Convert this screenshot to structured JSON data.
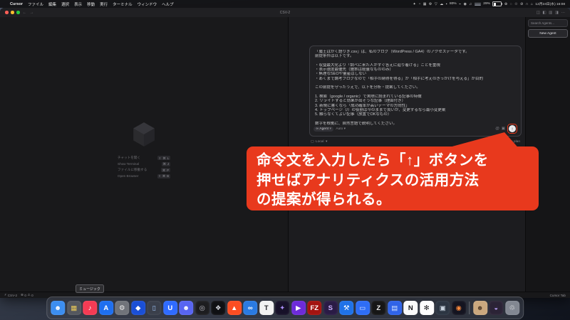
{
  "colors": {
    "annotation_red": "#e8391d",
    "window_bg": "#1a1a1c",
    "accent_send": "#e9e9ec"
  },
  "menubar": {
    "apple_icon": "",
    "app_name": "Cursor",
    "menus": [
      "ファイル",
      "編集",
      "選択",
      "表示",
      "移動",
      "実行",
      "ターミナル",
      "ウィンドウ",
      "ヘルプ"
    ],
    "icons_a": [
      "✦",
      "◔",
      "▦",
      "⚙",
      "▽",
      "☁",
      "▪"
    ],
    "kb_pct": "80%",
    "icons_b": [
      "⌁",
      "◉",
      "♫"
    ],
    "battery_pct": "29%",
    "icons_c": [
      "⊕",
      "◌",
      "♲",
      "⊘",
      "∩",
      "⌂"
    ],
    "datetime": "12月24日(水) 16:08"
  },
  "window": {
    "title": "CSV-2",
    "nav_back": "←",
    "nav_forward": "→",
    "titlebar_icons": [
      "◫",
      "◧",
      "▥",
      "◨",
      "⋯"
    ]
  },
  "welcome": {
    "shortcuts": [
      {
        "label": "チャットを開く",
        "keys": "⇧ ⌘ L"
      },
      {
        "label": "Show Terminal",
        "keys": "⌘ J"
      },
      {
        "label": "ファイルに移動する",
        "keys": "⌘ P"
      },
      {
        "label": "Open Browser",
        "keys": "⇧ ⌘ B"
      }
    ]
  },
  "chat": {
    "prompt_lines": [
      "「魔王はかく語りき.csv」は、私のブログ（WordPress / GA4）のアクセスデータです。",
      "前提条件は以下です。",
      "",
      "・収益最大化より「調べに来た人がすぐ答えに辿り着ける」ことを重視",
      "・表示速度最優先（施策は軽量なもののみ）",
      "・無理なSEOや量産はしない",
      "・あくまで論考ブログなので「相手の納得を得る」か「相手に考えのきっかけを与える」が目的",
      "",
      "この前提を守ったうえで、以下を分析・提案してください。",
      "",
      "1. 検索（google / organic）で実際に読まれている記事の特徴",
      "2. リライトすると効果が出そうな記事（理由付き）",
      "3. 新規に書くなら「成功確率が高いテーマの方向性」",
      "4. トップページ（/）の役割は今のままで良いか、変更するなら最小変更案",
      "5. 触らなくてよい記事（放置でOKなもの）",
      "",
      "数字を根拠に、自然言語で説明してください。"
    ],
    "mode_icon": "∞",
    "mode_label": "Agent",
    "chevron": "▾",
    "model_label": "Auto",
    "attach_icons": [
      "@",
      "▣"
    ],
    "send_icon": "↑",
    "env_icon": "▢",
    "env_label": "Local",
    "hint_keys": [
      "⇧⏎",
      "Tab"
    ],
    "hint_suffix": "to plan"
  },
  "agents_panel": {
    "search_placeholder": "Search Agents...",
    "new_agent_label": "New Agent"
  },
  "callout": {
    "text": "命令文を入力したら「↑」ボタンを\n押せばアナリティクスの活用方法\nの提案が得られる。"
  },
  "statusbar": {
    "remote_icon": "⚡",
    "branch": "CSV-2",
    "error_icon": "⊗",
    "errors": "0",
    "warning_icon": "⚠",
    "warnings": "0",
    "right_label": "Cursor Tab"
  },
  "tooltip": {
    "text": "ミュージック"
  },
  "dock": {
    "apps": [
      {
        "name": "finder",
        "glyph": "☻",
        "bg": "#3c8ef0",
        "fg": "#ffffff"
      },
      {
        "name": "launchpad",
        "glyph": "▦",
        "bg": "#54575e",
        "fg": "#e8c95a"
      },
      {
        "name": "music",
        "glyph": "♪",
        "bg": "#f43b54",
        "fg": "#ffffff"
      },
      {
        "name": "app-store",
        "glyph": "A",
        "bg": "#1e6ff0",
        "fg": "#ffffff"
      },
      {
        "name": "system-settings",
        "glyph": "⚙",
        "bg": "#70737a",
        "fg": "#ececec"
      },
      {
        "name": "bitwarden",
        "glyph": "◆",
        "bg": "#1a4fd6",
        "fg": "#ffffff"
      },
      {
        "name": "iphone-mirroring",
        "glyph": "▯",
        "bg": "#3a3f4b",
        "fg": "#9fc4f8"
      },
      {
        "name": "ulysses",
        "glyph": "U",
        "bg": "#2f6bff",
        "fg": "#ffffff"
      },
      {
        "name": "discord",
        "glyph": "☻",
        "bg": "#5865f2",
        "fg": "#ffffff"
      },
      {
        "name": "record-app",
        "glyph": "◎",
        "bg": "#1d1d20",
        "fg": "#b9b9c2"
      },
      {
        "name": "cursor",
        "glyph": "❖",
        "bg": "#0f1013",
        "fg": "#d6d9e0"
      },
      {
        "name": "brave",
        "glyph": "▲",
        "bg": "#fb4d22",
        "fg": "#ffffff"
      },
      {
        "name": "vscode",
        "glyph": "∞",
        "bg": "#2a7ae2",
        "fg": "#ffffff"
      },
      {
        "name": "typora",
        "glyph": "T",
        "bg": "#f2f2f2",
        "fg": "#26262b"
      },
      {
        "name": "purple-tool",
        "glyph": "✦",
        "bg": "#171129",
        "fg": "#a98df5"
      },
      {
        "name": "media-player",
        "glyph": "▶",
        "bg": "#6d2bd9",
        "fg": "#ffffff"
      },
      {
        "name": "filezilla",
        "glyph": "FZ",
        "bg": "#a31310",
        "fg": "#ffffff"
      },
      {
        "name": "scrivener",
        "glyph": "S",
        "bg": "#2a1b45",
        "fg": "#cbb4ff"
      },
      {
        "name": "xcode",
        "glyph": "⚒",
        "bg": "#1f72e8",
        "fg": "#ffffff"
      },
      {
        "name": "window-manager",
        "glyph": "▭",
        "bg": "#2e6df6",
        "fg": "#dfe9ff"
      },
      {
        "name": "zed",
        "glyph": "Z",
        "bg": "#161616",
        "fg": "#f0f0f0"
      },
      {
        "name": "wallet",
        "glyph": "▤",
        "bg": "#2f63e8",
        "fg": "#cfe0ff"
      },
      {
        "name": "notion",
        "glyph": "N",
        "bg": "#fafafa",
        "fg": "#17171b"
      },
      {
        "name": "chatgpt",
        "glyph": "✻",
        "bg": "#fdfdfd",
        "fg": "#1a1a1e"
      },
      {
        "name": "screenshot-tool",
        "glyph": "▣",
        "bg": "#2c3542",
        "fg": "#ccd6e2"
      },
      {
        "name": "photo-editor",
        "glyph": "◉",
        "bg": "#141420",
        "fg": "#ff8a3c"
      }
    ],
    "extras": [
      {
        "name": "portrait-file",
        "glyph": "☻",
        "bg": "#caa87e",
        "fg": "#58422c"
      },
      {
        "name": "utility",
        "glyph": "◒",
        "bg": "#2b2336",
        "fg": "#b49cf0"
      },
      {
        "name": "trash",
        "glyph": "♲",
        "bg": "rgba(152,157,167,0.8)",
        "fg": "#f4f4f4"
      }
    ]
  }
}
